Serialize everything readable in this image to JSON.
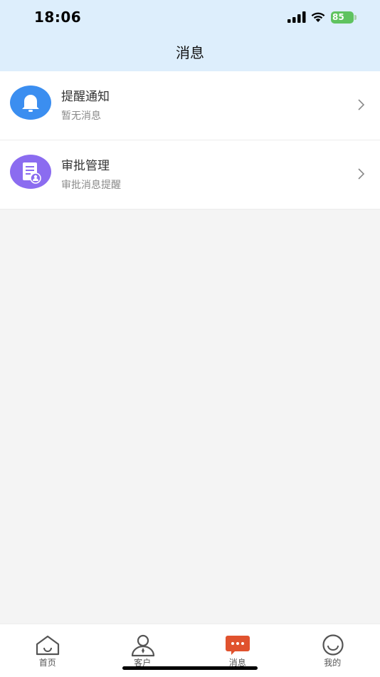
{
  "status_bar": {
    "time": "18:06",
    "battery": "85"
  },
  "nav": {
    "title": "消息"
  },
  "messages": [
    {
      "title": "提醒通知",
      "subtitle": "暂无消息",
      "icon": "bell-icon",
      "color": "#3b8ef0"
    },
    {
      "title": "审批管理",
      "subtitle": "审批消息提醒",
      "icon": "approval-document-icon",
      "color": "#8b6cf0"
    }
  ],
  "tabs": [
    {
      "label": "首页",
      "icon": "home-icon",
      "active": false
    },
    {
      "label": "客户",
      "icon": "customer-icon",
      "active": false
    },
    {
      "label": "消息",
      "icon": "message-icon",
      "active": true
    },
    {
      "label": "我的",
      "icon": "profile-smile-icon",
      "active": false
    }
  ],
  "colors": {
    "header_bg": "#ddeefc",
    "active_tab": "#e0522e",
    "page_bg": "#f4f4f4"
  }
}
